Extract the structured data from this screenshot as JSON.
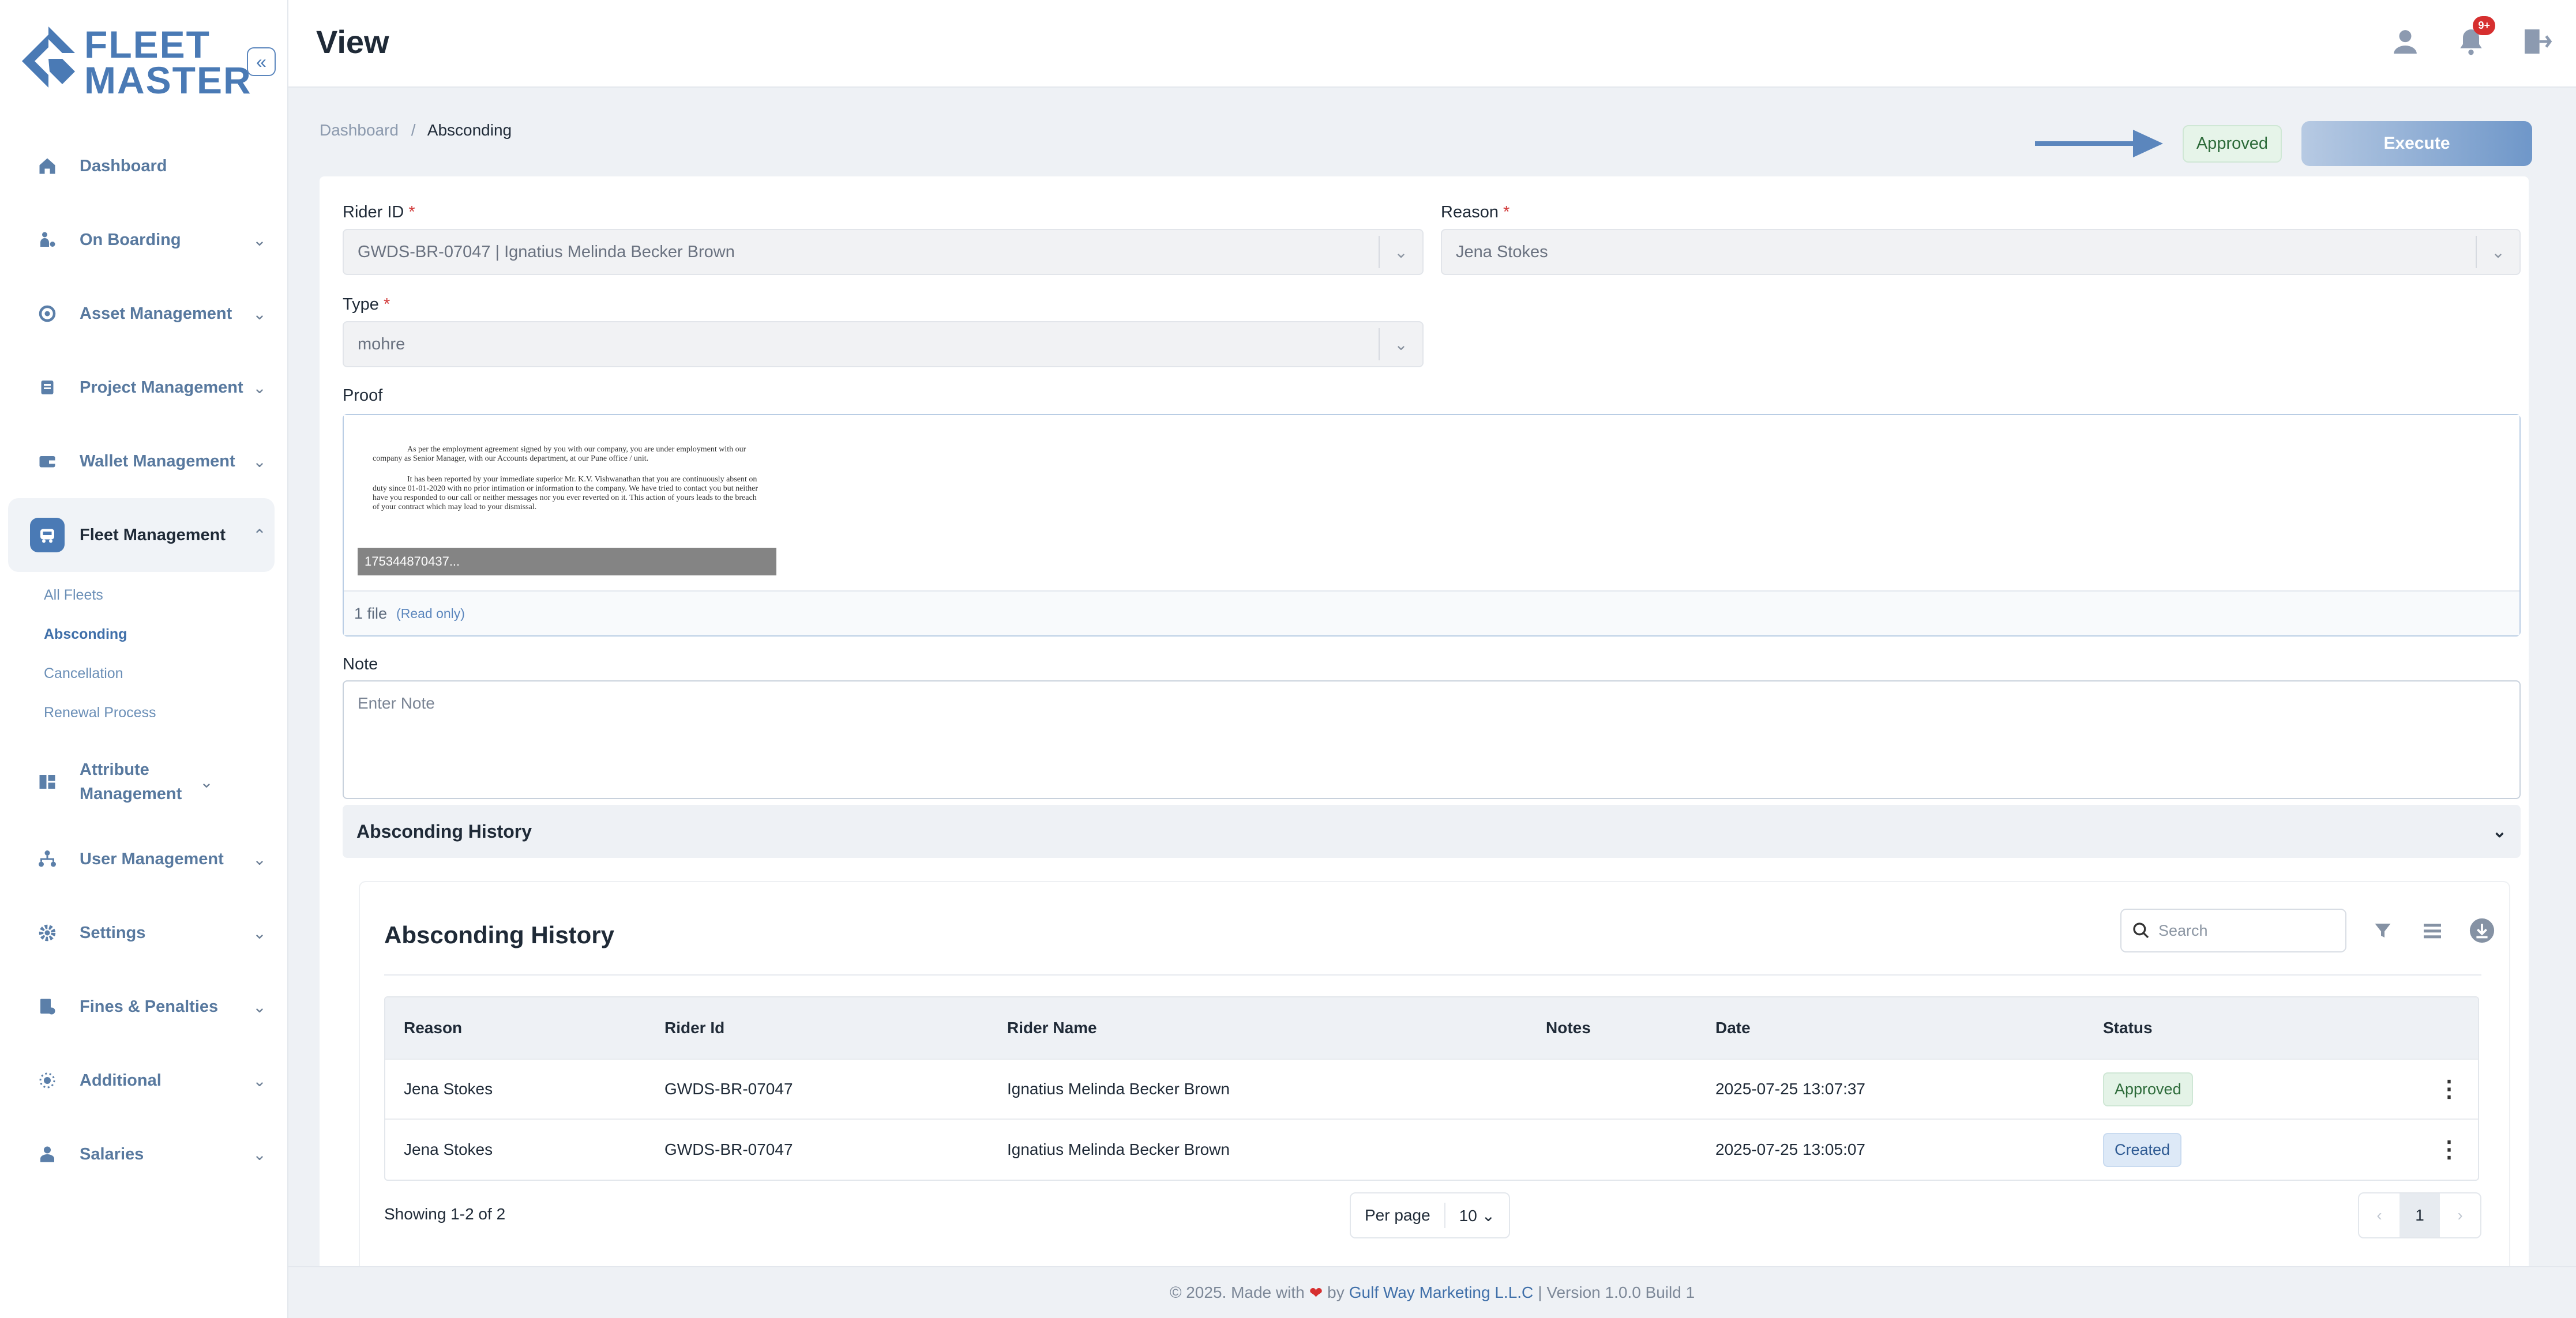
{
  "brand": {
    "line1": "FLEET",
    "line2": "MASTER",
    "accent": "#4a7ab5"
  },
  "sidebar": {
    "items": [
      {
        "label": "Dashboard",
        "icon": "home-icon"
      },
      {
        "label": "On Boarding",
        "icon": "onboarding-icon"
      },
      {
        "label": "Asset Management",
        "icon": "asset-icon"
      },
      {
        "label": "Project Management",
        "icon": "project-icon"
      },
      {
        "label": "Wallet Management",
        "icon": "wallet-icon"
      },
      {
        "label": "Fleet Management",
        "icon": "fleet-icon"
      },
      {
        "label": "Attribute Management",
        "icon": "attribute-icon"
      },
      {
        "label": "User Management",
        "icon": "users-icon"
      },
      {
        "label": "Settings",
        "icon": "gear-icon"
      },
      {
        "label": "Fines & Penalties",
        "icon": "fines-icon"
      },
      {
        "label": "Additional",
        "icon": "additional-icon"
      },
      {
        "label": "Salaries",
        "icon": "salaries-icon"
      }
    ],
    "fleet_sub": [
      "All Fleets",
      "Absconding",
      "Cancellation",
      "Renewal Process"
    ]
  },
  "header": {
    "title": "View",
    "notif_badge": "9+"
  },
  "breadcrumb": {
    "root": "Dashboard",
    "sep": "/",
    "current": "Absconding"
  },
  "status": {
    "label": "Approved",
    "execute": "Execute"
  },
  "form": {
    "rider_label": "Rider ID",
    "rider_value": "GWDS-BR-07047 | Ignatius Melinda Becker Brown",
    "reason_label": "Reason",
    "reason_value": "Jena Stokes",
    "type_label": "Type",
    "type_value": "mohre",
    "required_mark": "*",
    "proof_label": "Proof",
    "proof_count": "1 file",
    "proof_readonly": "(Read only)",
    "proof_filename": "175344870437...",
    "proof_p1": "As per the employment agreement signed by you with our company, you are under employment with our company as Senior Manager, with our Accounts department, at our Pune office / unit.",
    "proof_p2": "It has been reported by your immediate superior Mr. K.V. Vishwanathan that you are continuously absent on duty since 01-01-2020 with no prior intimation or information to the company. We have tried to contact you but neither have you responded to our call or neither messages nor you ever reverted on it. This action of yours leads to the breach of your contract which may lead to your dismissal.",
    "note_label": "Note",
    "note_placeholder": "Enter Note"
  },
  "history": {
    "accordion_title": "Absconding History",
    "title": "Absconding History",
    "search_placeholder": "Search",
    "columns": [
      "Reason",
      "Rider Id",
      "Rider Name",
      "Notes",
      "Date",
      "Status"
    ],
    "rows": [
      {
        "reason": "Jena Stokes",
        "rider_id": "GWDS-BR-07047",
        "rider_name": "Ignatius Melinda Becker Brown",
        "notes": "",
        "date": "2025-07-25 13:07:37",
        "status": "Approved"
      },
      {
        "reason": "Jena Stokes",
        "rider_id": "GWDS-BR-07047",
        "rider_name": "Ignatius Melinda Becker Brown",
        "notes": "",
        "date": "2025-07-25 13:05:07",
        "status": "Created"
      }
    ],
    "showing": "Showing 1-2 of 2",
    "per_page_label": "Per page",
    "per_page_value": "10",
    "page": "1"
  },
  "footer": {
    "prefix": "© 2025. Made with",
    "by": "by",
    "company": "Gulf Way Marketing L.L.C",
    "suffix": "| Version 1.0.0 Build 1"
  }
}
